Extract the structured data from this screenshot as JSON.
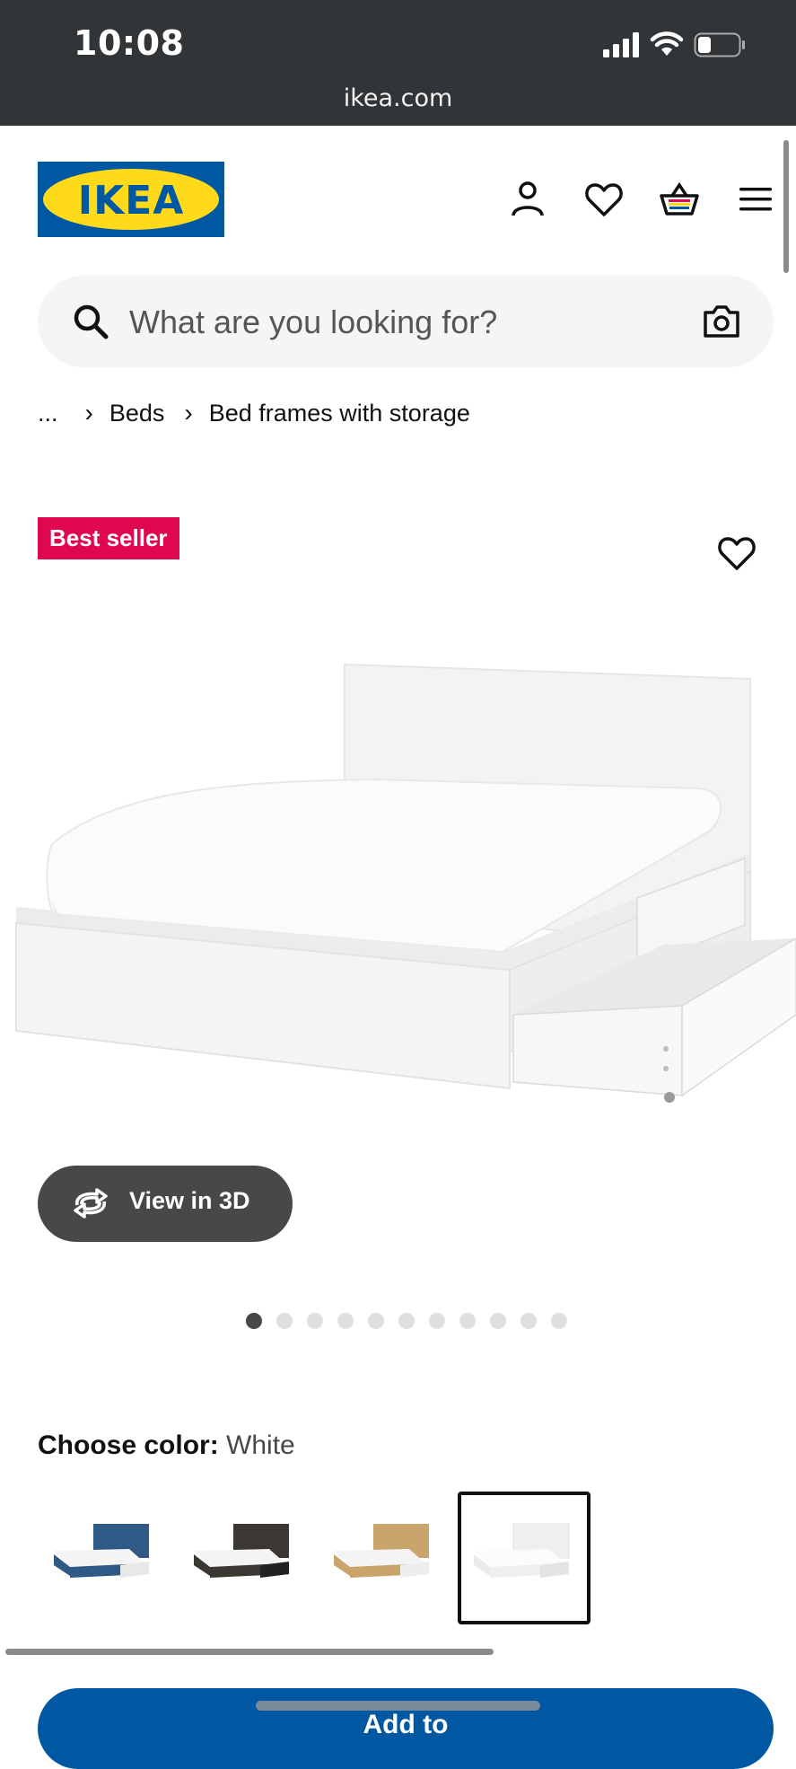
{
  "status_bar": {
    "time": "10:08",
    "url": "ikea.com"
  },
  "header": {
    "logo_text": "IKEA",
    "icons": [
      "account-icon",
      "heart-icon",
      "cart-icon",
      "menu-icon"
    ]
  },
  "search": {
    "placeholder": "What are you looking for?"
  },
  "breadcrumb": {
    "ellipsis": "...",
    "items": [
      "Beds",
      "Bed frames with storage"
    ]
  },
  "product": {
    "badge": "Best seller",
    "view3d_label": "View in 3D",
    "image_count": 11,
    "active_image": 1
  },
  "color": {
    "label": "Choose color:",
    "value": "White",
    "options": [
      {
        "name": "blue",
        "hex": "#2e5a85"
      },
      {
        "name": "black-brown",
        "hex": "#3b3833"
      },
      {
        "name": "oak",
        "hex": "#c9a56b"
      },
      {
        "name": "white",
        "hex": "#f2f2f2",
        "selected": true
      }
    ]
  },
  "cta": {
    "label": "Add to"
  },
  "colors": {
    "ikea_blue": "#0058a3",
    "ikea_yellow": "#ffda1a",
    "badge_red": "#e00751"
  }
}
